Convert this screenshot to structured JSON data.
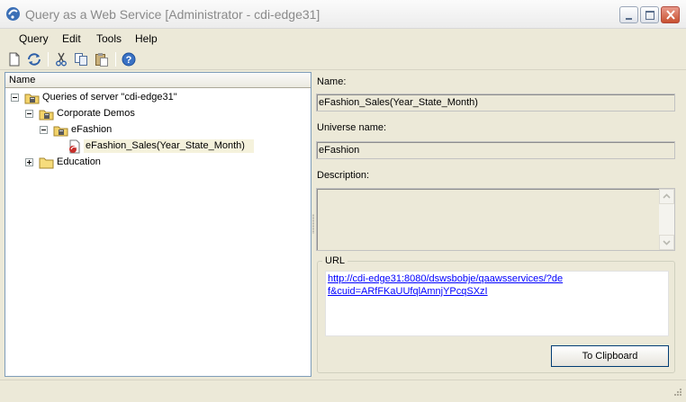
{
  "window": {
    "title": "Query as a Web Service [Administrator - cdi-edge31]"
  },
  "menu": {
    "items": [
      "Query",
      "Edit",
      "Tools",
      "Help"
    ]
  },
  "toolbar": {
    "icons": [
      "new-icon",
      "refresh-icon",
      "cut-icon",
      "copy-icon",
      "paste-icon",
      "help-icon"
    ]
  },
  "tree": {
    "header": "Name",
    "nodes": [
      {
        "label": "Queries of server \"cdi-edge31\"",
        "icon": "server-folder-icon",
        "expanded": true
      },
      {
        "label": "Corporate Demos",
        "icon": "folder-icon",
        "expanded": true
      },
      {
        "label": "eFashion",
        "icon": "folder-icon",
        "expanded": true
      },
      {
        "label": "eFashion_Sales(Year_State_Month)",
        "icon": "query-icon",
        "selected": true
      },
      {
        "label": "Education",
        "icon": "folder-icon",
        "expanded": false
      }
    ]
  },
  "details": {
    "name_label": "Name:",
    "name_value": "eFashion_Sales(Year_State_Month)",
    "universe_label": "Universe name:",
    "universe_value": "eFashion",
    "description_label": "Description:",
    "description_value": "",
    "url_legend": "URL",
    "url_value": "http://cdi-edge31:8080/dswsbobje/qaawsservices/?def&cuid=ARfFKaUUfqlAmnjYPcqSXzI",
    "clipboard_button": "To Clipboard"
  },
  "colors": {
    "link": "#0000ff",
    "selection": "#f5f2dc",
    "window_bg": "#ece9d8"
  }
}
